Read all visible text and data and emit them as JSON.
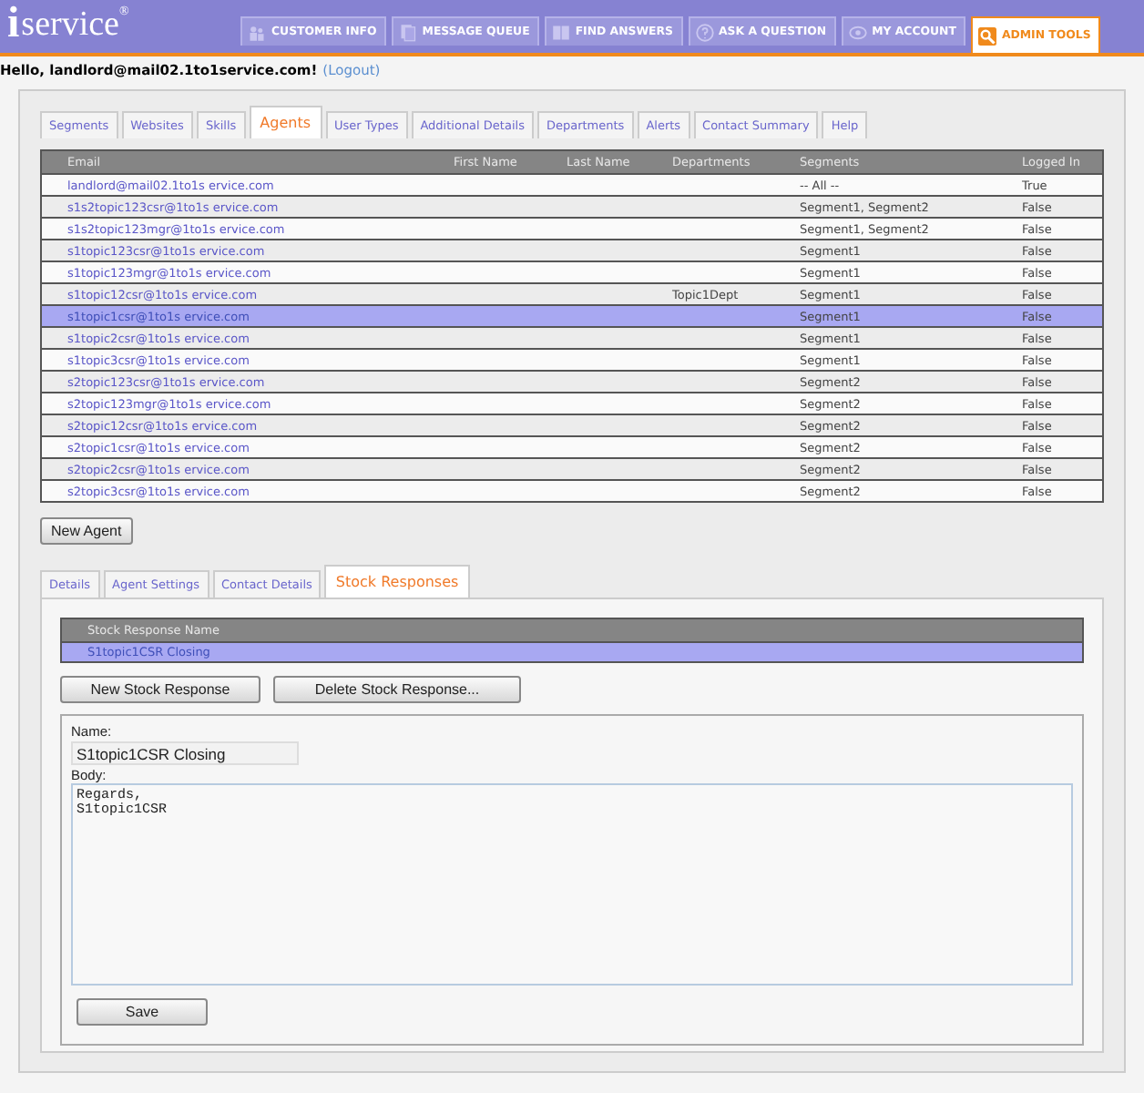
{
  "header": {
    "logo_letter": "i",
    "logo": "service",
    "logo_mark": "®",
    "nav": [
      {
        "label": "CUSTOMER INFO",
        "selected": false
      },
      {
        "label": "MESSAGE QUEUE",
        "selected": false
      },
      {
        "label": "FIND ANSWERS",
        "selected": false
      },
      {
        "label": "ASK A QUESTION",
        "selected": false
      },
      {
        "label": "MY ACCOUNT",
        "selected": false
      },
      {
        "label": "ADMIN TOOLS",
        "selected": true
      }
    ]
  },
  "greeting": "Hello, landlord@mail02.1to1service.com!",
  "logout": "(Logout)",
  "tabs": [
    {
      "label": "Segments",
      "selected": false
    },
    {
      "label": "Websites",
      "selected": false
    },
    {
      "label": "Skills",
      "selected": false
    },
    {
      "label": "Agents",
      "selected": true
    },
    {
      "label": "User Types",
      "selected": false
    },
    {
      "label": "Additional Details",
      "selected": false
    },
    {
      "label": "Departments",
      "selected": false
    },
    {
      "label": "Alerts",
      "selected": false
    },
    {
      "label": "Contact Summary",
      "selected": false
    },
    {
      "label": "Help",
      "selected": false
    }
  ],
  "agents_table": {
    "columns": [
      "Email",
      "First Name",
      "Last Name",
      "Departments",
      "Segments",
      "Logged In"
    ],
    "rows": [
      {
        "email": "landlord@mail02.1to1s ervice.com",
        "department": "",
        "segments": "-- All --",
        "logged_in": "True",
        "selected": false
      },
      {
        "email": "s1s2topic123csr@1to1s ervice.com",
        "department": "",
        "segments": "Segment1, Segment2",
        "logged_in": "False",
        "selected": false
      },
      {
        "email": "s1s2topic123mgr@1to1s ervice.com",
        "department": "",
        "segments": "Segment1, Segment2",
        "logged_in": "False",
        "selected": false
      },
      {
        "email": "s1topic123csr@1to1s ervice.com",
        "department": "",
        "segments": "Segment1",
        "logged_in": "False",
        "selected": false
      },
      {
        "email": "s1topic123mgr@1to1s ervice.com",
        "department": "",
        "segments": "Segment1",
        "logged_in": "False",
        "selected": false
      },
      {
        "email": "s1topic12csr@1to1s ervice.com",
        "department": "Topic1Dept",
        "segments": "Segment1",
        "logged_in": "False",
        "selected": false
      },
      {
        "email": "s1topic1csr@1to1s ervice.com",
        "department": "",
        "segments": "Segment1",
        "logged_in": "False",
        "selected": true
      },
      {
        "email": "s1topic2csr@1to1s ervice.com",
        "department": "",
        "segments": "Segment1",
        "logged_in": "False",
        "selected": false
      },
      {
        "email": "s1topic3csr@1to1s ervice.com",
        "department": "",
        "segments": "Segment1",
        "logged_in": "False",
        "selected": false
      },
      {
        "email": "s2topic123csr@1to1s ervice.com",
        "department": "",
        "segments": "Segment2",
        "logged_in": "False",
        "selected": false
      },
      {
        "email": "s2topic123mgr@1to1s ervice.com",
        "department": "",
        "segments": "Segment2",
        "logged_in": "False",
        "selected": false
      },
      {
        "email": "s2topic12csr@1to1s ervice.com",
        "department": "",
        "segments": "Segment2",
        "logged_in": "False",
        "selected": false
      },
      {
        "email": "s2topic1csr@1to1s ervice.com",
        "department": "",
        "segments": "Segment2",
        "logged_in": "False",
        "selected": false
      },
      {
        "email": "s2topic2csr@1to1s ervice.com",
        "department": "",
        "segments": "Segment2",
        "logged_in": "False",
        "selected": false
      },
      {
        "email": "s2topic3csr@1to1s ervice.com",
        "department": "",
        "segments": "Segment2",
        "logged_in": "False",
        "selected": false
      }
    ]
  },
  "new_agent_button": "New Agent",
  "sub_tabs": [
    {
      "label": "Details",
      "selected": false
    },
    {
      "label": "Agent Settings",
      "selected": false
    },
    {
      "label": "Contact Details",
      "selected": false
    },
    {
      "label": "Stock Responses",
      "selected": true
    }
  ],
  "responses_table": {
    "column": "Stock Response Name",
    "rows": [
      {
        "name": "S1topic1CSR Closing",
        "selected": true
      }
    ]
  },
  "response_buttons": [
    "New Stock Response",
    "Delete Stock Response..."
  ],
  "form": {
    "name_label": "Name:",
    "name_value": "S1topic1CSR Closing",
    "body_label": "Body:",
    "body_value": "Regards,\nS1topic1CSR",
    "save_button": "Save"
  }
}
